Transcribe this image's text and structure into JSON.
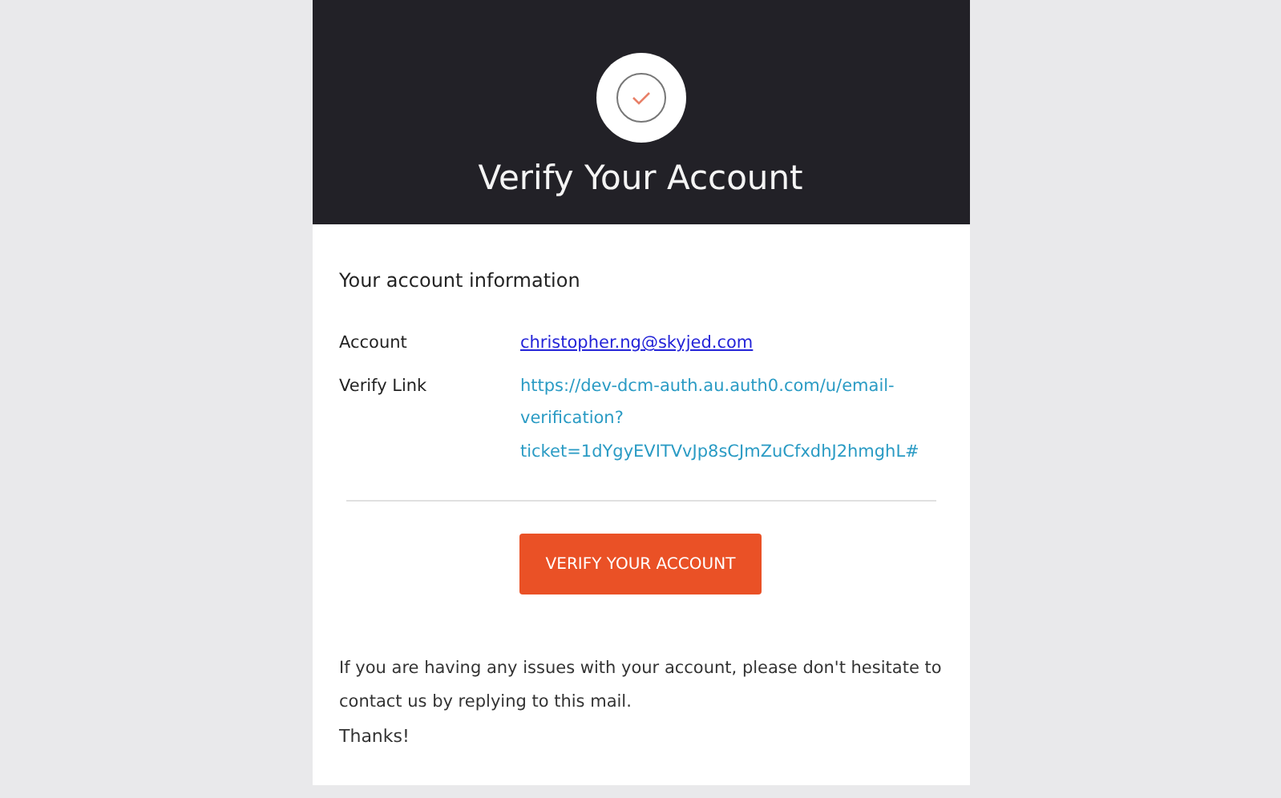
{
  "header": {
    "title": "Verify Your Account"
  },
  "section_title": "Your account information",
  "fields": [
    {
      "label": "Account",
      "value": "christopher.ng@skyjed.com",
      "kind": "email"
    },
    {
      "label": "Verify Link",
      "value": "https://dev-dcm-auth.au.auth0.com/u/email-verification?ticket=1dYgyEVITVvJp8sCJmZuCfxdhJ2hmghL#",
      "kind": "url"
    }
  ],
  "button": "VERIFY YOUR ACCOUNT",
  "message": "If you are having any issues with your account, please don't hesitate to contact us by replying to this mail.",
  "sign_off": "Thanks!"
}
